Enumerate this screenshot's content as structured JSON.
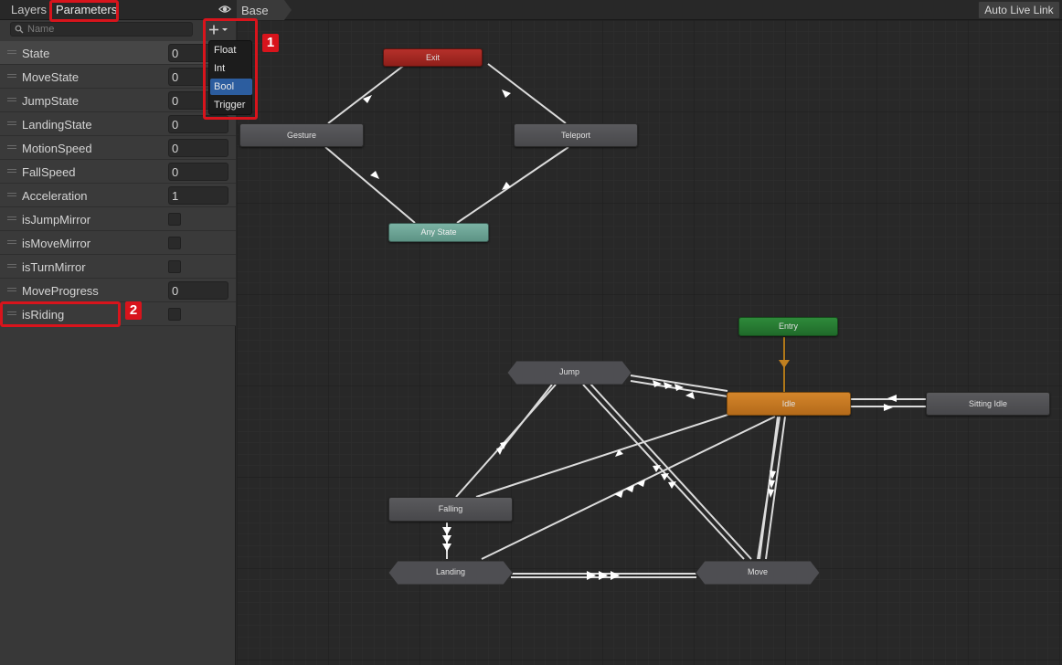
{
  "tabs": {
    "layers": "Layers",
    "parameters": "Parameters"
  },
  "search": {
    "placeholder": "Name"
  },
  "parameters": [
    {
      "name": "State",
      "type": "int",
      "value": "0"
    },
    {
      "name": "MoveState",
      "type": "int",
      "value": "0"
    },
    {
      "name": "JumpState",
      "type": "int",
      "value": "0"
    },
    {
      "name": "LandingState",
      "type": "int",
      "value": "0"
    },
    {
      "name": "MotionSpeed",
      "type": "float",
      "value": "0"
    },
    {
      "name": "FallSpeed",
      "type": "float",
      "value": "0"
    },
    {
      "name": "Acceleration",
      "type": "float",
      "value": "1"
    },
    {
      "name": "isJumpMirror",
      "type": "bool",
      "checked": false
    },
    {
      "name": "isMoveMirror",
      "type": "bool",
      "checked": false
    },
    {
      "name": "isTurnMirror",
      "type": "bool",
      "checked": false
    },
    {
      "name": "MoveProgress",
      "type": "float",
      "value": "0"
    },
    {
      "name": "isRiding",
      "type": "bool",
      "checked": false
    }
  ],
  "dropdown": {
    "items": [
      "Float",
      "Int",
      "Bool",
      "Trigger"
    ],
    "selected": "Bool"
  },
  "badges": {
    "one": "1",
    "two": "2"
  },
  "breadcrumb": {
    "base": "Base"
  },
  "toolbar": {
    "auto_live_link": "Auto Live Link"
  },
  "nodes": {
    "exit": "Exit",
    "gesture": "Gesture",
    "teleport": "Teleport",
    "any_state": "Any State",
    "entry": "Entry",
    "jump": "Jump",
    "idle": "Idle",
    "sitting_idle": "Sitting Idle",
    "falling": "Falling",
    "landing": "Landing",
    "move": "Move"
  },
  "colors": {
    "highlight": "#d8141c",
    "exit_node": "#a82a24",
    "entry_node": "#267a30",
    "any_state_node": "#6da394",
    "default_state": "#c47a22",
    "selection": "#2c5d9f"
  }
}
